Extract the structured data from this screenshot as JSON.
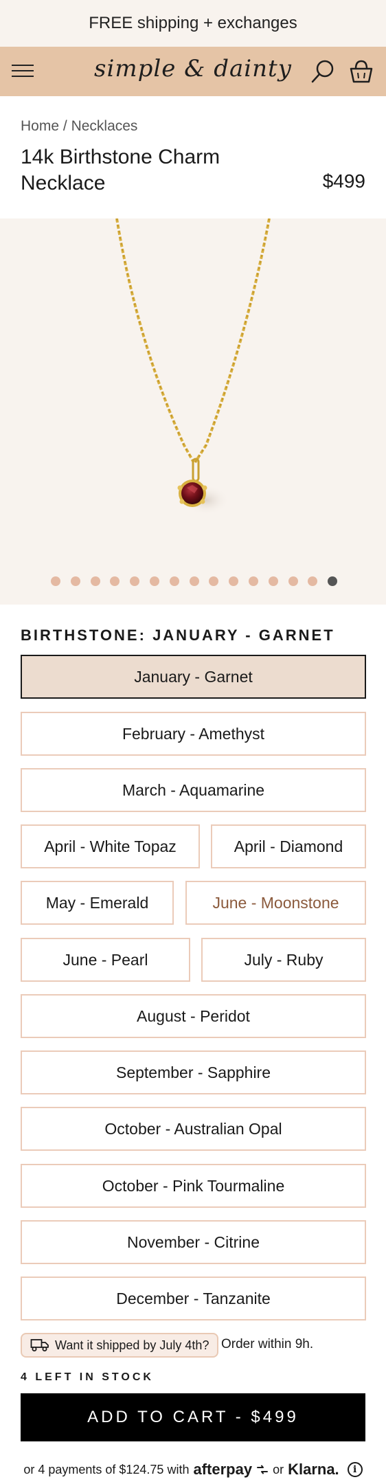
{
  "promo": {
    "text": "FREE shipping + exchanges"
  },
  "header": {
    "logo": "simple & dainty",
    "menu_icon": "hamburger-menu-icon",
    "search_icon": "search-icon",
    "cart_icon": "shopping-basket-icon",
    "background": "#e5c4a6"
  },
  "breadcrumb": {
    "home": "Home",
    "separator": "/",
    "category": "Necklaces"
  },
  "product": {
    "title": "14k Birthstone Charm Necklace",
    "price": "$499"
  },
  "gallery": {
    "image_count": 15,
    "active_index": 14,
    "dot_color": "#e4b9a2",
    "active_dot_color": "#555555"
  },
  "variant": {
    "label": "BIRTHSTONE:",
    "selected_value": "JANUARY - GARNET",
    "options": [
      "January - Garnet",
      "February - Amethyst",
      "March - Aquamarine",
      "April - White Topaz",
      "April - Diamond",
      "May - Emerald",
      "June - Moonstone",
      "June - Pearl",
      "July - Ruby",
      "August - Peridot",
      "September - Sapphire",
      "October - Australian Opal",
      "October - Pink Tourmaline",
      "November - Citrine",
      "December - Tanzanite"
    ]
  },
  "shipping": {
    "pill_text": "Want it shipped by July 4th?",
    "icon": "delivery-truck-icon",
    "order_text": "Order within 9h."
  },
  "stock": {
    "text": "4 LEFT IN STOCK"
  },
  "cart": {
    "button_label": "ADD TO CART - $499"
  },
  "bnpl": {
    "prefix": "or 4 payments of $124.75 with",
    "afterpay": "afterpay",
    "or": "or",
    "klarna": "Klarna.",
    "info_icon": "info-icon"
  }
}
